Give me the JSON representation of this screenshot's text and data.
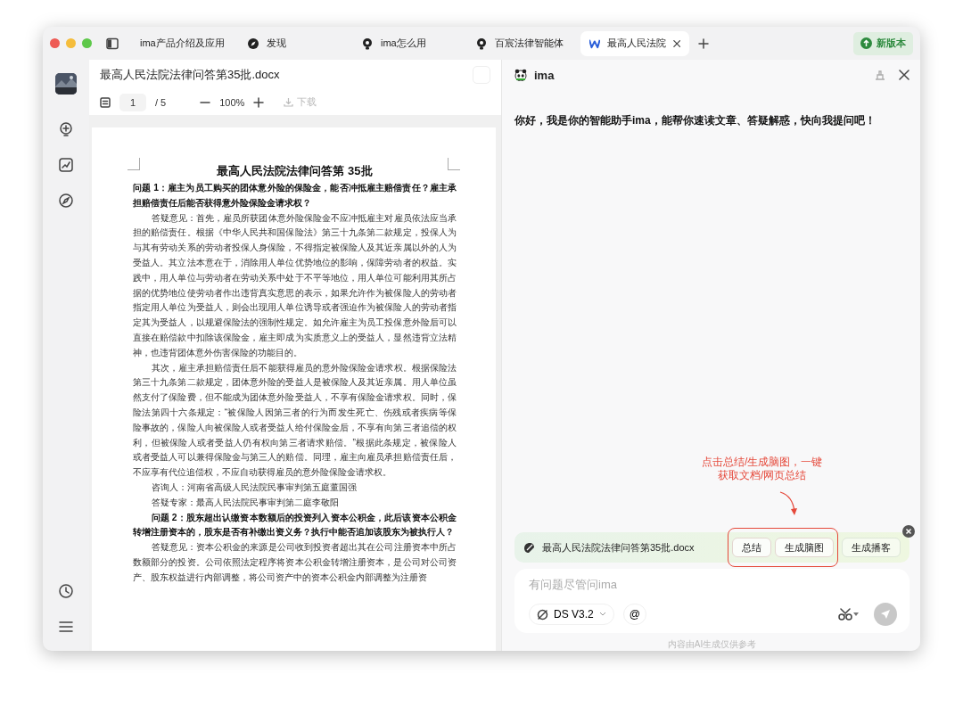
{
  "tabs": [
    {
      "label": "ima产品介绍及应用",
      "selected": false
    },
    {
      "label": "发现",
      "selected": false
    },
    {
      "label": "ima怎么用",
      "selected": false
    },
    {
      "label": "百宸法律智能体",
      "selected": false
    },
    {
      "label": "最高人民法院",
      "selected": true
    }
  ],
  "update_button": "新版本",
  "document": {
    "filename": "最高人民法院法律问答第35批.docx",
    "page": "1",
    "pages": "/ 5",
    "zoom": "100%",
    "download": "下载",
    "title": "最高人民法院法律问答第 35批",
    "paragraphs": [
      {
        "kind": "lead",
        "text": "问题 1：雇主为员工购买的团体意外险的保险金，能否冲抵雇主赔偿责任？雇主承担赔偿责任后能否获得意外险保险金请求权？"
      },
      {
        "kind": "body",
        "text": "答疑意见：首先，雇员所获团体意外险保险金不应冲抵雇主对雇员依法应当承担的赔偿责任。根据《中华人民共和国保险法》第三十九条第二款规定，投保人为与其有劳动关系的劳动者投保人身保险，不得指定被保险人及其近亲属以外的人为受益人。其立法本意在于，消除用人单位优势地位的影响，保障劳动者的权益。实践中，用人单位与劳动者在劳动关系中处于不平等地位，用人单位可能利用其所占据的优势地位使劳动者作出违背真实意思的表示，如果允许作为被保险人的劳动者指定用人单位为受益人，则会出现用人单位诱导或者强迫作为被保险人的劳动者指定其为受益人，以规避保险法的强制性规定。如允许雇主为员工投保意外险后可以直接在赔偿款中扣除该保险金，雇主即成为实质意义上的受益人，显然违背立法精神，也违背团体意外伤害保险的功能目的。"
      },
      {
        "kind": "body",
        "text": "其次，雇主承担赔偿责任后不能获得雇员的意外险保险金请求权。根据保险法第三十九条第二款规定，团体意外险的受益人是被保险人及其近亲属。用人单位虽然支付了保险费，但不能成为团体意外险受益人，不享有保险金请求权。同时，保险法第四十六条规定：“被保险人因第三者的行为而发生死亡、伤残或者疾病等保险事故的，保险人向被保险人或者受益人给付保险金后，不享有向第三者追偿的权利，但被保险人或者受益人仍有权向第三者请求赔偿。”根据此条规定，被保险人或者受益人可以兼得保险金与第三人的赔偿。同理，雇主向雇员承担赔偿责任后，不应享有代位追偿权，不应自动获得雇员的意外险保险金请求权。"
      },
      {
        "kind": "body",
        "text": "咨询人：河南省高级人民法院民事审判第五庭董国强"
      },
      {
        "kind": "body",
        "text": "答疑专家：最高人民法院民事审判第二庭李敬阳"
      },
      {
        "kind": "question",
        "text": "问题 2：股东超出认缴资本数额后的投资列入资本公积金，此后该资本公积金转增注册资本的，股东是否有补缴出资义务？执行中能否追加该股东为被执行人？"
      },
      {
        "kind": "body",
        "text": "答疑意见：资本公积金的来源是公司收到投资者超出其在公司注册资本中所占数额部分的投资。公司依照法定程序将资本公积金转增注册资本，是公司对公司资产、股东权益进行内部调整，将公司资产中的资本公积金内部调整为注册资"
      }
    ]
  },
  "assistant": {
    "name": "ima",
    "greeting": "你好，我是你的智能助手ima，能帮你速读文章、答疑解惑，快向我提问吧！",
    "annotation": [
      "点击总结/生成脑图，一键",
      "获取文档/网页总结"
    ],
    "context": {
      "filename": "最高人民法院法律问答第35批.docx",
      "actions": [
        {
          "label": "总结",
          "highlighted": true
        },
        {
          "label": "生成脑图",
          "highlighted": true
        },
        {
          "label": "生成播客",
          "highlighted": false
        }
      ]
    },
    "input": {
      "placeholder": "有问题尽管问ima",
      "model": "DS V3.2",
      "mention": "@"
    },
    "disclaimer": "内容由AI生成仅供参考"
  }
}
